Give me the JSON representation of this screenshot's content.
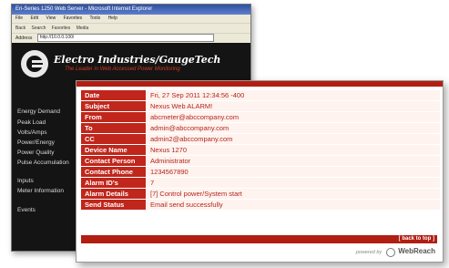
{
  "browser": {
    "title": "Eri-Series 1250 Web Server - Microsoft Internet Explorer",
    "menu": [
      "File",
      "Edit",
      "View",
      "Favorites",
      "Tools",
      "Help"
    ],
    "toolbar": [
      "Back",
      "Search",
      "Favorites",
      "Media"
    ],
    "address_label": "Address",
    "address_value": "http://10.0.0.100/"
  },
  "brand": {
    "name": "Electro Industries/GaugeTech",
    "tagline": "The Leader in Web Accessed Power Monitoring"
  },
  "nav": [
    "Energy Demand",
    "Peak Load",
    "Volts/Amps",
    "Power/Energy",
    "Power Quality",
    "Pulse Accumulation",
    "Inputs",
    "Meter Information",
    "Events"
  ],
  "email": {
    "rows": [
      {
        "label": "Date",
        "value": "Fri, 27 Sep 2011 12:34:56 -400"
      },
      {
        "label": "Subject",
        "value": "Nexus Web ALARM!"
      },
      {
        "label": "From",
        "value": "abcmeter@abccompany.com"
      },
      {
        "label": "To",
        "value": "admin@abccompany.com"
      },
      {
        "label": "CC",
        "value": "admin2@abccompany.com"
      },
      {
        "label": "Device Name",
        "value": "Nexus 1270"
      },
      {
        "label": "Contact Person",
        "value": "Administrator"
      },
      {
        "label": "Contact Phone",
        "value": "1234567890"
      },
      {
        "label": "Alarm ID's",
        "value": "7"
      },
      {
        "label": "Alarm Details",
        "value": "[7] Control power/System start"
      },
      {
        "label": "Send Status",
        "value": "Email send successfully"
      }
    ],
    "back_to_top": "[ back to top ]"
  },
  "footer": {
    "powered_by": "powered by",
    "product": "WebReach"
  },
  "colors": {
    "accent_red": "#c0261b",
    "banner_black": "#141414",
    "value_text": "#b3261b"
  }
}
